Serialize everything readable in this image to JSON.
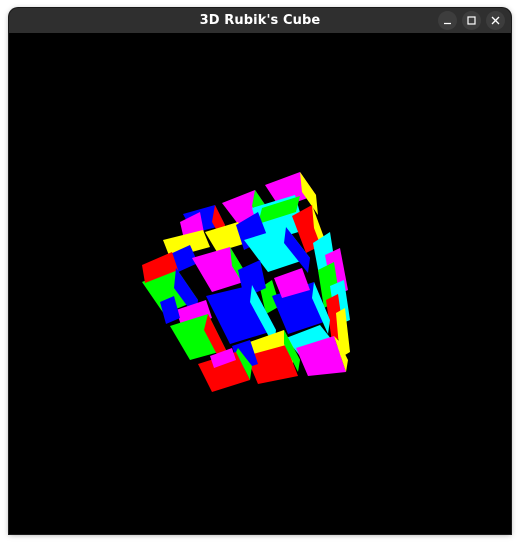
{
  "window": {
    "title": "3D Rubik's Cube",
    "controls": {
      "minimize_icon": "minimize-icon",
      "maximize_icon": "maximize-icon",
      "close_icon": "close-icon"
    }
  },
  "colors": {
    "titlebar": "#2f2f2f",
    "title_text": "#ffffff",
    "viewport_background": "#000000",
    "cube_faces": [
      "#ff0000",
      "#00ff00",
      "#0000ff",
      "#ffff00",
      "#ff00ff",
      "#00ffff"
    ]
  }
}
